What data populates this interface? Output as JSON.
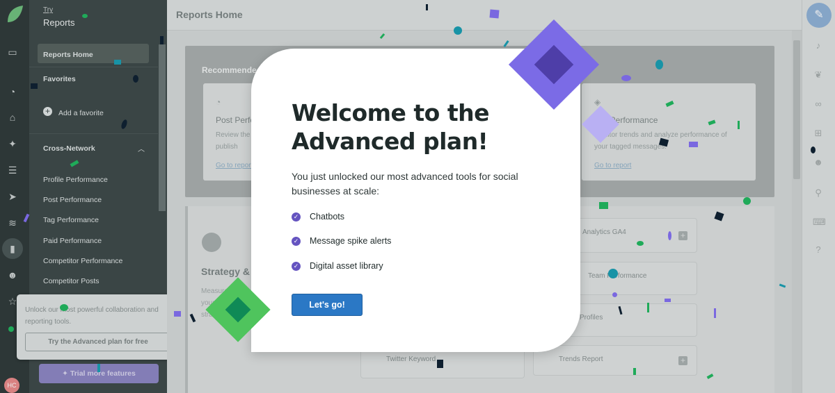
{
  "colors": {
    "accent_blue": "#2b78c5",
    "accent_purple": "#6554c0",
    "confetti_green": "#1faa59",
    "confetti_teal": "#1893a6",
    "confetti_navy": "#0e1f2f",
    "confetti_purple": "#7a68e0"
  },
  "rail": {
    "avatar_initials": "HC",
    "icons": [
      "logo-icon",
      "folder-icon",
      "dashboard-icon",
      "inbox-icon",
      "pin-icon",
      "list-icon",
      "send-icon",
      "audio-icon",
      "reports-icon",
      "people-icon",
      "star-icon"
    ]
  },
  "nav": {
    "try_label": "Try",
    "section_title": "Reports",
    "home_label": "Reports Home",
    "favorites_label": "Favorites",
    "add_favorite_label": "Add a favorite",
    "cross_network_label": "Cross-Network",
    "items": [
      "Profile Performance",
      "Post Performance",
      "Tag Performance",
      "Paid Performance",
      "Competitor Performance",
      "Competitor Posts"
    ],
    "trial_button": "Trial more features"
  },
  "upgrade_card": {
    "text": "Unlock our most powerful collaboration and reporting tools.",
    "button": "Try the Advanced plan for free"
  },
  "main": {
    "page_title": "Reports Home",
    "recommended_heading": "Recommended",
    "recommended_cards": [
      {
        "title": "Post Performance",
        "description": "Review the performance of the posts you publish",
        "link": "Go to report"
      },
      {
        "title": "Tag Performance",
        "description": "Monitor trends and analyze performance of your tagged messages.",
        "link": "Go to report"
      }
    ],
    "strategy": {
      "title": "Strategy & Planning",
      "description": "Measure your trends strategy"
    },
    "tiles": {
      "analytics": "Analytics GA4",
      "team": "Team Performance",
      "profiles": "Profiles",
      "twitter": "Twitter Keyword",
      "trends": "Trends Report"
    }
  },
  "modal": {
    "title": "Welcome to the Advanced plan!",
    "description": "You just unlocked our most advanced tools for social businesses at scale:",
    "features": [
      "Chatbots",
      "Message spike alerts",
      "Digital asset library"
    ],
    "cta": "Let's go!"
  }
}
